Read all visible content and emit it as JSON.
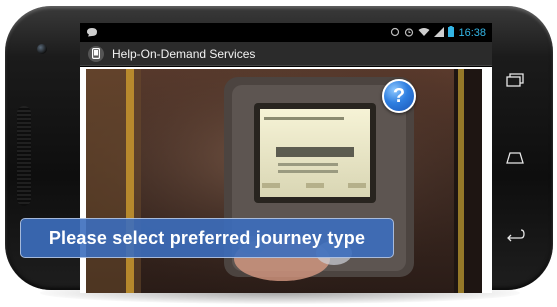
{
  "status_bar": {
    "time": "16:38",
    "icons": [
      "bbm-icon",
      "sync-icon",
      "alarm-icon",
      "wifi-icon",
      "signal-icon",
      "battery-icon"
    ]
  },
  "action_bar": {
    "icon": "phone-app-icon",
    "title": "Help-On-Demand Services"
  },
  "video": {
    "caption": "Please select preferred journey type",
    "help_icon": "question-mark-icon",
    "help_label": "?"
  },
  "nav_buttons": [
    "recent-apps-icon",
    "home-icon",
    "back-icon"
  ],
  "colors": {
    "accent": "#33b5e5",
    "caption_bg": "#3c6ebe",
    "action_bar": "#2b2b2b"
  }
}
